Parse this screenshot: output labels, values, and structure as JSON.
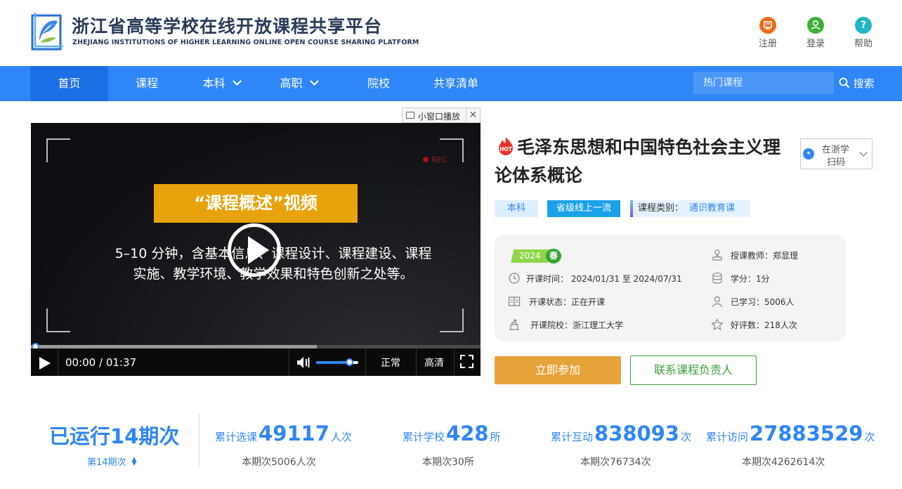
{
  "header": {
    "title": "浙江省高等学校在线开放课程共享平台",
    "subtitle": "ZHEJIANG INSTITUTIONS OF HIGHER LEARNING ONLINE OPEN COURSE SHARING PLATFORM",
    "links": [
      {
        "label": "注册",
        "icon": "register-icon",
        "color": "#f26a1b"
      },
      {
        "label": "登录",
        "icon": "user-icon",
        "color": "#3cb035"
      },
      {
        "label": "帮助",
        "icon": "help-icon",
        "color": "#21b5c4"
      }
    ]
  },
  "nav": {
    "items": [
      "首页",
      "课程",
      "本科",
      "高职",
      "院校",
      "共享清单"
    ],
    "active_index": 0,
    "search_placeholder": "热门课程",
    "search_label": "搜索",
    "bg_color": "#2f86f6"
  },
  "player": {
    "mini_label": "小窗口播放",
    "close": "✕",
    "rec": "REC",
    "banner": "“课程概述”视频",
    "desc_line1": "5–10 分钟，含基本信息、课程设计、课程建设、课程",
    "desc_line2": "实施、教学环境、教学效果和特色创新之处等。",
    "time": "00:00 / 01:37",
    "speed": "正常",
    "quality": "高清",
    "volume_level": 0.8
  },
  "course": {
    "hot_badge": "HOT",
    "title": "毛泽东思想和中国特色社会主义理论体系概论",
    "scan_line1": "在浙学",
    "scan_line2": "扫码",
    "tags": {
      "level": "本科",
      "award": "省级线上一流",
      "category_label": "课程类别：",
      "category_value": "通识教育课"
    },
    "season_year": "2024",
    "season": "春",
    "open_time": "开课时间：  2024/01/31 至 2024/07/31",
    "status": "开课状态：正在开课",
    "school": "开课院校：浙江理工大学",
    "teacher": "授课教师：郑显理",
    "credit": "学分：1分",
    "learners": "已学习：5006人",
    "rating": "好评数：218人次",
    "join_label": "立即参加",
    "contact_label": "联系课程负责人",
    "accent": "#e6a33a",
    "green": "#3ea13a"
  },
  "stats": {
    "run": "已运行14期次",
    "period": "第14期次",
    "items": [
      {
        "label": "累计选课",
        "num": "49117",
        "unit": "人次",
        "sub": "本期次5006人次"
      },
      {
        "label": "累计学校",
        "num": "428",
        "unit": "所",
        "sub": "本期次30所"
      },
      {
        "label": "累计互动",
        "num": "838093",
        "unit": "次",
        "sub": "本期次76734次"
      },
      {
        "label": "累计访问",
        "num": "27883529",
        "unit": "次",
        "sub": "本期次4262614次"
      }
    ]
  }
}
